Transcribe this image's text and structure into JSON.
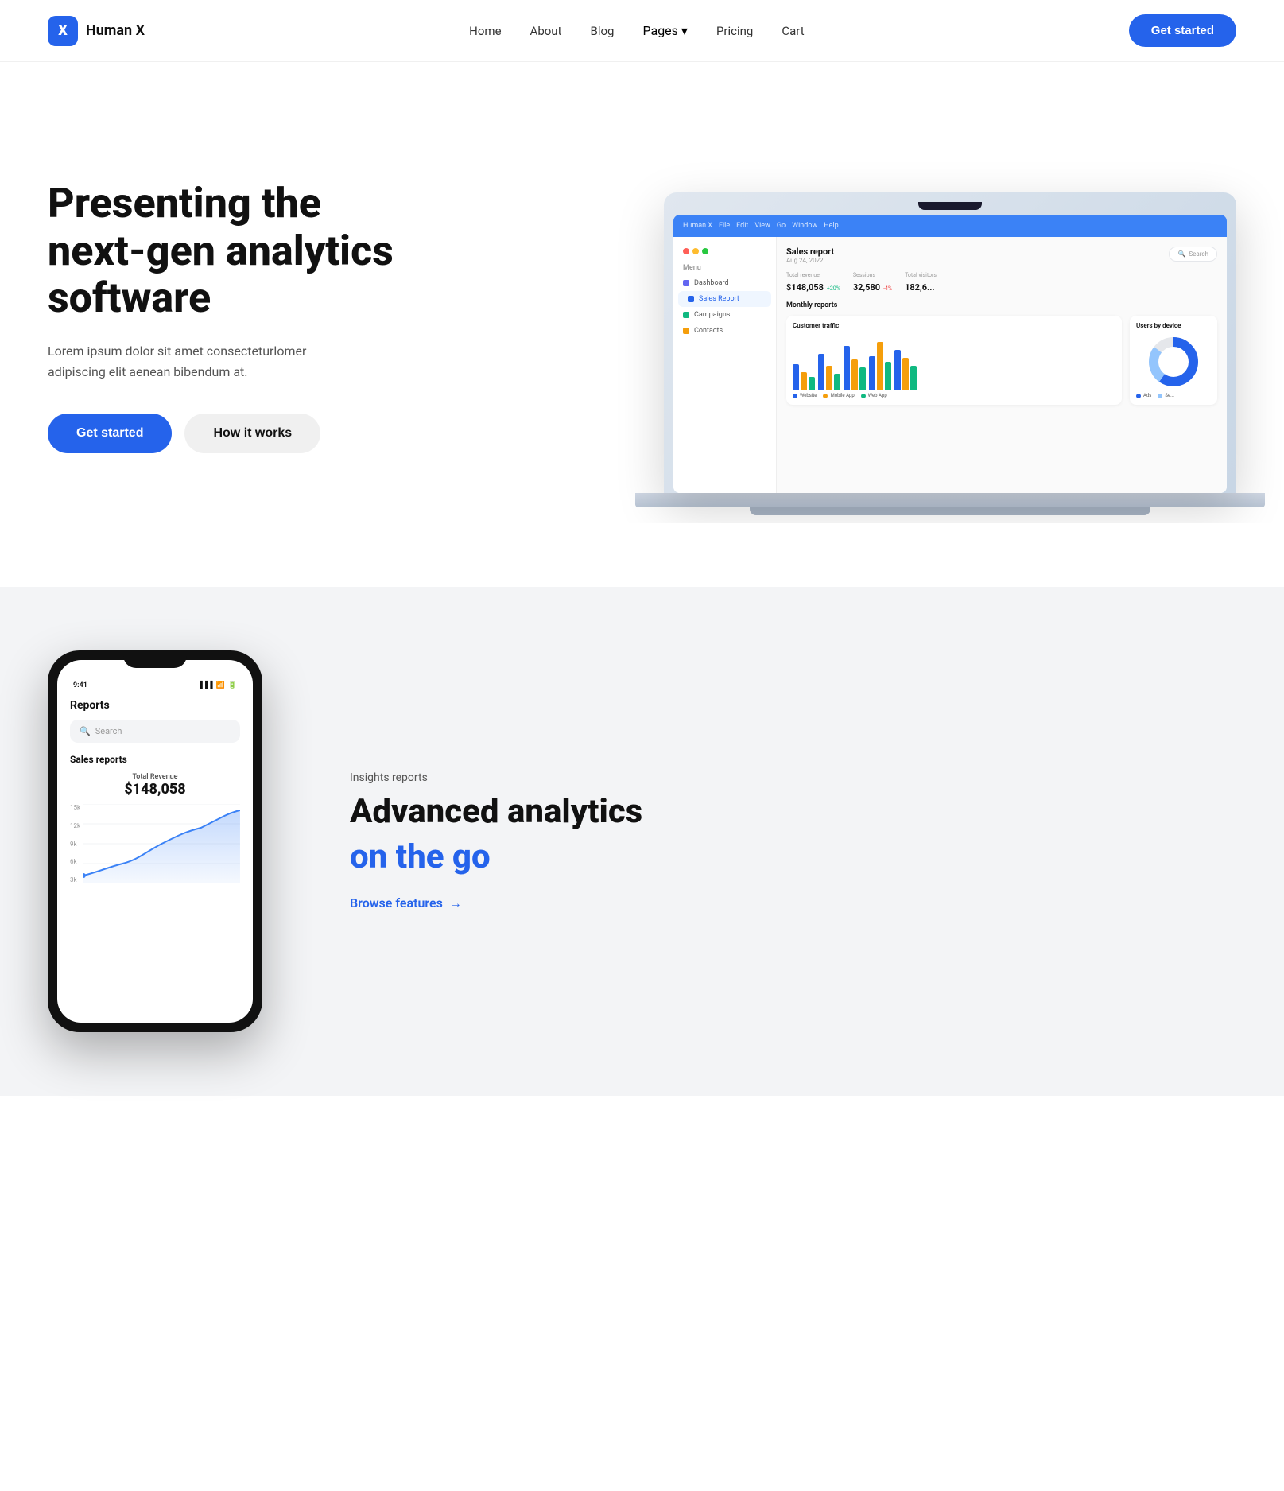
{
  "brand": {
    "logo_letter": "X",
    "name": "Human X"
  },
  "nav": {
    "links": [
      "Home",
      "About",
      "Blog",
      "Pages",
      "Pricing",
      "Cart"
    ],
    "pages_has_dropdown": true,
    "cta_label": "Get started"
  },
  "hero": {
    "title": "Presenting the next-gen analytics software",
    "subtitle": "Lorem ipsum dolor sit amet consecteturlomer adipiscing elit aenean bibendum at.",
    "cta_primary": "Get started",
    "cta_secondary": "How it works"
  },
  "laptop_screen": {
    "topbar_items": [
      "Human X",
      "File",
      "Edit",
      "View",
      "Go",
      "Window",
      "Help"
    ],
    "report_title": "Sales report",
    "report_date": "Aug 24, 2022",
    "search_placeholder": "Search",
    "sidebar_menu_label": "Menu",
    "sidebar_items": [
      "Dashboard",
      "Sales Report",
      "Campaigns",
      "Contacts"
    ],
    "stats": [
      {
        "label": "Total revenue",
        "value": "$148,058",
        "change": "+20%",
        "positive": true
      },
      {
        "label": "Sessions",
        "value": "32,580",
        "change": "-4%",
        "positive": false
      },
      {
        "label": "Total visitors",
        "value": "182,6...",
        "change": "",
        "positive": true
      }
    ],
    "monthly_label": "Monthly reports",
    "chart1_title": "Customer traffic",
    "chart1_legend": [
      "Website",
      "Mobile App",
      "Web App"
    ],
    "chart2_title": "Users by device",
    "chart2_legend": [
      "Ads",
      "Se..."
    ]
  },
  "section2": {
    "label": "Insights reports",
    "title_line1": "Advanced analytics",
    "title_line2": "on the go",
    "browse_label": "Browse features",
    "phone_time": "9:41",
    "phone_header": "Reports",
    "phone_search_placeholder": "Search",
    "phone_section": "Sales reports",
    "phone_stat_label": "Total Revenue",
    "phone_stat_value": "$148,058",
    "chart_y_labels": [
      "15k",
      "12k",
      "9k",
      "6k",
      "3k"
    ]
  }
}
